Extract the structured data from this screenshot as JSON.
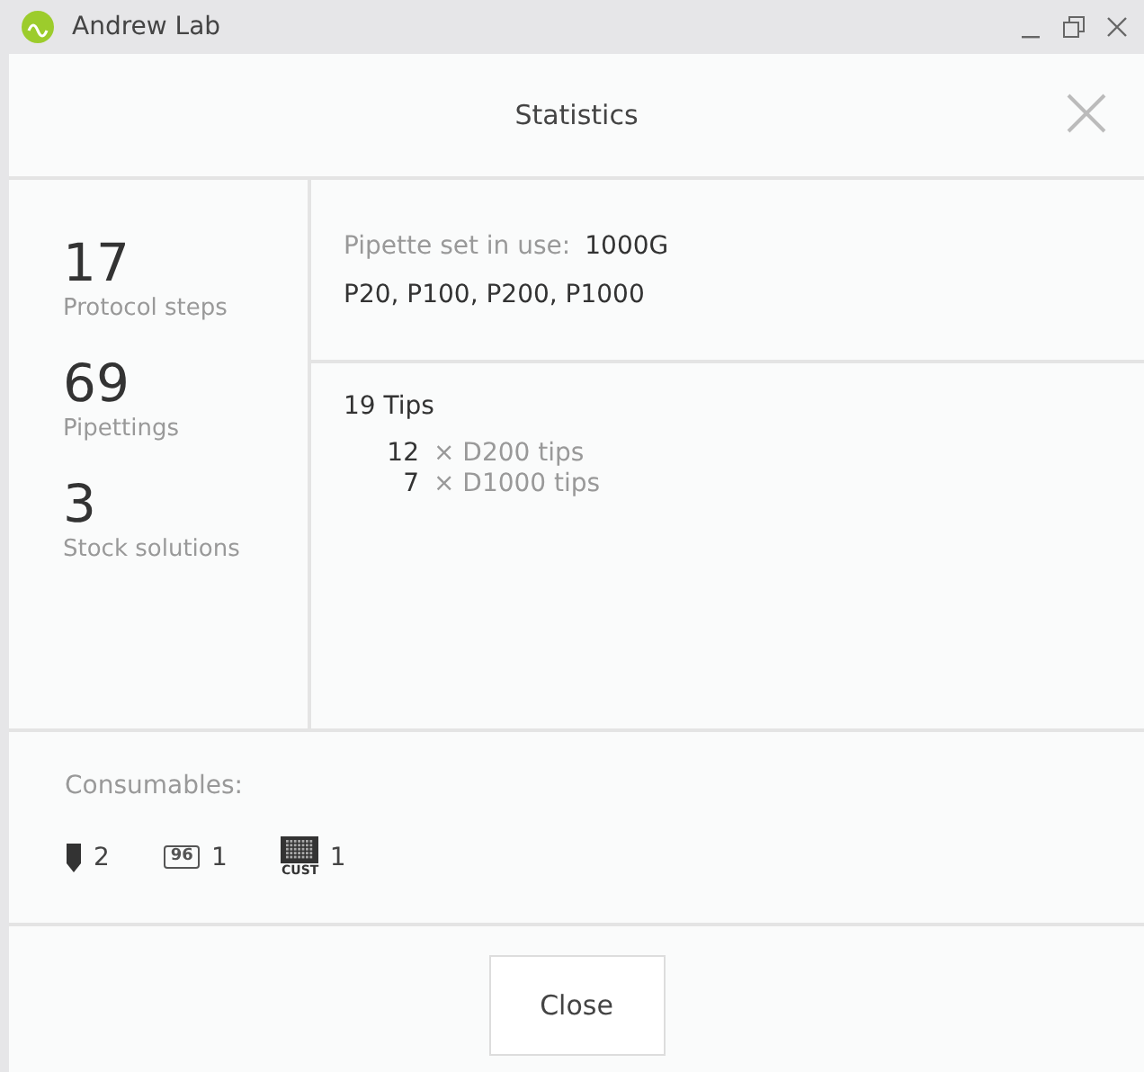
{
  "window": {
    "title": "Andrew Lab"
  },
  "dialog": {
    "title": "Statistics"
  },
  "stats": [
    {
      "value": "17",
      "label": "Protocol steps"
    },
    {
      "value": "69",
      "label": "Pipettings"
    },
    {
      "value": "3",
      "label": "Stock solutions"
    }
  ],
  "pipette_set": {
    "label": "Pipette set in use:",
    "value": "1000G",
    "pipettes": "P20, P100, P200, P1000"
  },
  "tips": {
    "total": "19 Tips",
    "items": [
      {
        "count": "12",
        "name": "× D200 tips"
      },
      {
        "count": "7",
        "name": "× D1000 tips"
      }
    ]
  },
  "consumables": {
    "label": "Consumables:",
    "items": [
      {
        "kind": "tube",
        "count": "2"
      },
      {
        "kind": "plate",
        "icon_text": "96",
        "count": "1"
      },
      {
        "kind": "custom",
        "icon_text": "CUST",
        "count": "1"
      }
    ]
  },
  "buttons": [
    "Close"
  ]
}
